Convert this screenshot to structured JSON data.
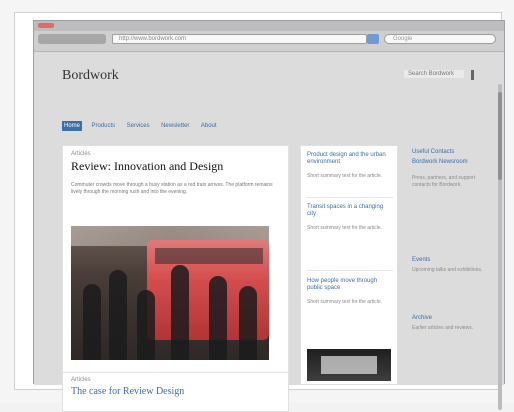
{
  "browser": {
    "url": "http://www.bordwork.com",
    "search_placeholder": "Google"
  },
  "site": {
    "name": "Bordwork",
    "search_label": "Search Bordwork",
    "nav": [
      "Home",
      "Products",
      "Services",
      "Newsletter",
      "About"
    ]
  },
  "lead": {
    "kicker": "Articles",
    "headline": "Review: Innovation and Design",
    "lede": "Commuter crowds move through a busy station as a red train arrives. The platform remains lively through the morning rush and into the evening."
  },
  "bottom_card": {
    "kicker": "Articles",
    "title": "The case for Review Design"
  },
  "middle": {
    "item1_title": "Product design and the urban environment",
    "item1_text": "Short summary text for the article.",
    "item2_title": "Transit spaces in a changing city",
    "item2_text": "Short summary text for the article.",
    "item3_title": "How people move through public space",
    "item3_text": "Short summary text for the article."
  },
  "sidebar": {
    "title1": "Useful Contacts",
    "title2": "Bordwork Newsroom",
    "text1": "Press, partners, and support contacts for Bordwork.",
    "title3": "Events",
    "text2": "Upcoming talks and exhibitions.",
    "title4": "Archive",
    "text3": "Earlier articles and reviews."
  },
  "colors": {
    "accent": "#3b6ea5",
    "train_red": "#d44d4d"
  }
}
